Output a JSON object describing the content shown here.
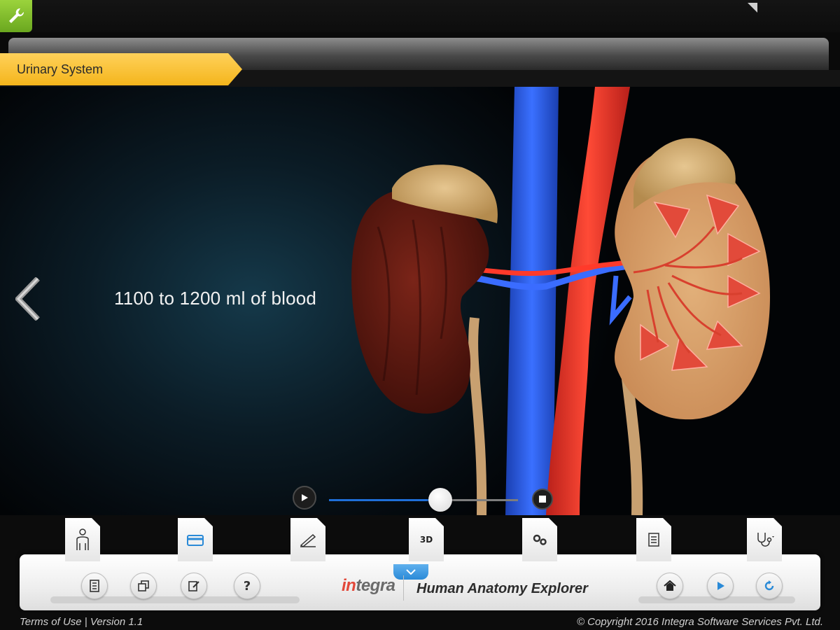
{
  "header": {
    "section_title": "Urinary System"
  },
  "stage": {
    "caption": "1100 to 1200 ml of blood",
    "playback": {
      "progress": 0.59
    }
  },
  "toolbar": {
    "tabs": [
      {
        "icon": "body-outline-icon",
        "label": ""
      },
      {
        "icon": "card-icon",
        "label": ""
      },
      {
        "icon": "pen-edit-icon",
        "label": ""
      },
      {
        "icon": "3d-icon",
        "label": "3D"
      },
      {
        "icon": "gears-icon",
        "label": ""
      },
      {
        "icon": "notes-icon",
        "label": ""
      },
      {
        "icon": "stethoscope-icon",
        "label": ""
      }
    ],
    "left_buttons": [
      "book-icon",
      "copy-icon",
      "edit-icon",
      "help-icon"
    ],
    "help_label": "?",
    "right_buttons": [
      "home-icon",
      "play-icon",
      "refresh-icon"
    ],
    "logo_part1": "in",
    "logo_part2": "tegra",
    "app_title": "Human Anatomy Explorer"
  },
  "footer": {
    "left": "Terms of Use |  Version 1.1",
    "right": "© Copyright 2016 Integra Software Services Pvt. Ltd."
  },
  "colors": {
    "accent_yellow": "#f4b51c",
    "accent_green": "#7dbb2a",
    "accent_blue": "#1f6fd8",
    "vein_blue": "#2a5fe0",
    "artery_red": "#e83a2a"
  }
}
